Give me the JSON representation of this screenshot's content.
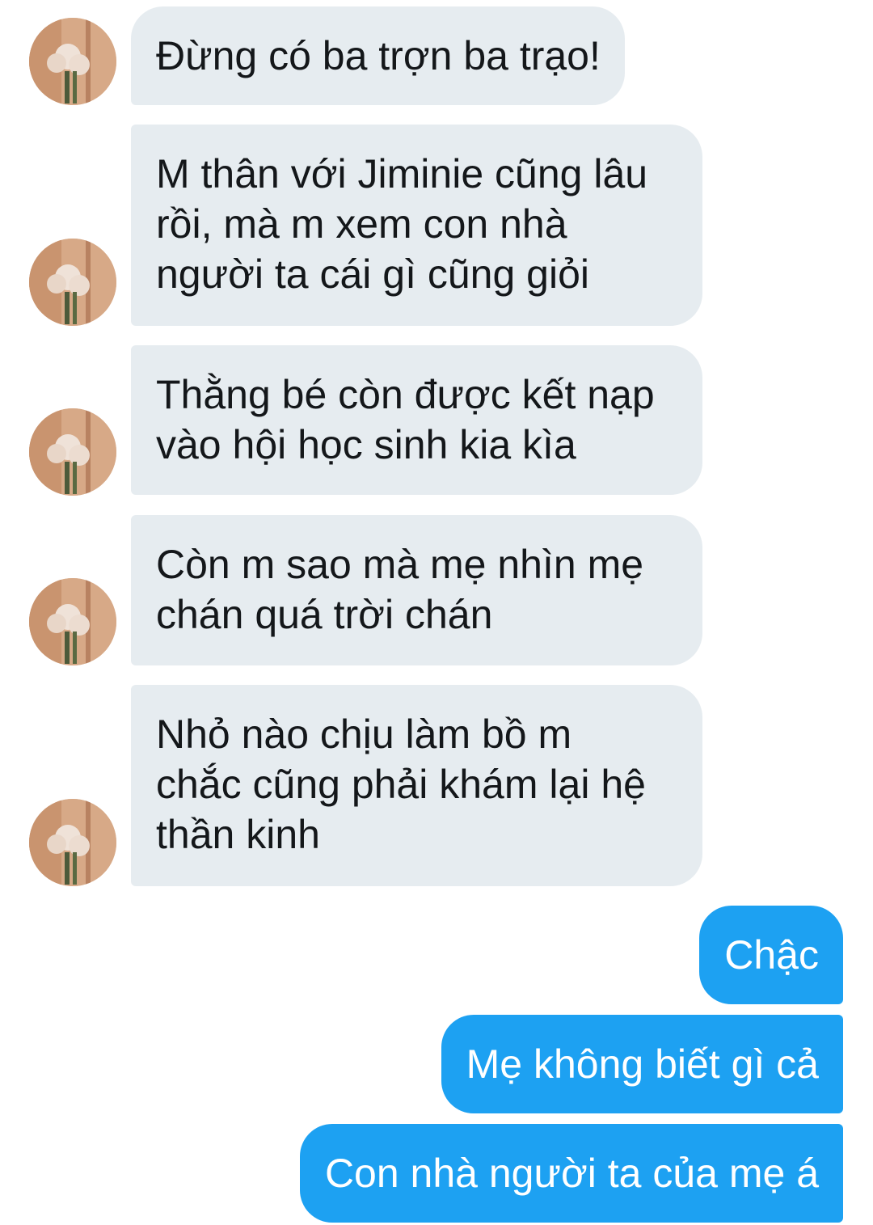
{
  "conversation": {
    "received": [
      {
        "text": "Đừng có ba trợn ba trạo!"
      },
      {
        "text": "M thân với Jiminie cũng lâu\nrồi, mà m xem con nhà\nngười ta cái gì cũng giỏi"
      },
      {
        "text": "Thằng bé còn được kết nạp\nvào hội học sinh kia kìa"
      },
      {
        "text": "Còn m sao mà mẹ nhìn mẹ\nchán quá trời chán"
      },
      {
        "text": "Nhỏ nào chịu làm bồ m\nchắc cũng phải khám lại hệ\nthần kinh"
      }
    ],
    "sent": [
      {
        "text": "Chậc"
      },
      {
        "text": "Mẹ không biết gì cả"
      },
      {
        "text": "Con nhà người ta của mẹ á"
      }
    ]
  },
  "avatar": {
    "icon": "flower-bouquet-avatar-icon"
  },
  "colors": {
    "received_bubble": "#e6ecf0",
    "received_text": "#14171a",
    "sent_bubble": "#1da1f2",
    "sent_text": "#ffffff"
  }
}
